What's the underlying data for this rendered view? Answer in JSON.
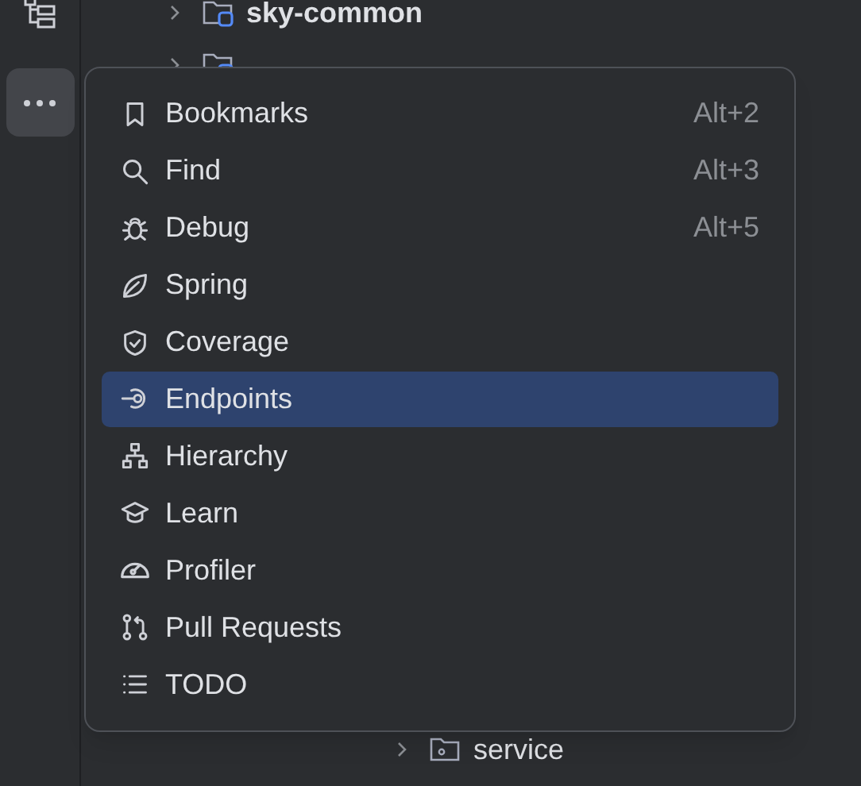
{
  "tree": {
    "items": [
      {
        "label": "sky-common",
        "expanded": false,
        "kind": "module"
      },
      {
        "expanded": false,
        "kind": "module"
      }
    ],
    "lower_items": [
      {
        "label": "service",
        "expanded": false,
        "kind": "package"
      }
    ]
  },
  "menu": {
    "items": [
      {
        "label": "Bookmarks",
        "shortcut": "Alt+2",
        "kind": "bookmark",
        "selected": false
      },
      {
        "label": "Find",
        "shortcut": "Alt+3",
        "kind": "search",
        "selected": false
      },
      {
        "label": "Debug",
        "shortcut": "Alt+5",
        "kind": "bug",
        "selected": false
      },
      {
        "label": "Spring",
        "kind": "leaf",
        "selected": false
      },
      {
        "label": "Coverage",
        "kind": "shield",
        "selected": false
      },
      {
        "label": "Endpoints",
        "kind": "endpoint",
        "selected": true
      },
      {
        "label": "Hierarchy",
        "kind": "hierarchy",
        "selected": false
      },
      {
        "label": "Learn",
        "kind": "cap",
        "selected": false
      },
      {
        "label": "Profiler",
        "kind": "gauge",
        "selected": false
      },
      {
        "label": "Pull Requests",
        "kind": "pr",
        "selected": false
      },
      {
        "label": "TODO",
        "kind": "list",
        "selected": false
      }
    ]
  }
}
